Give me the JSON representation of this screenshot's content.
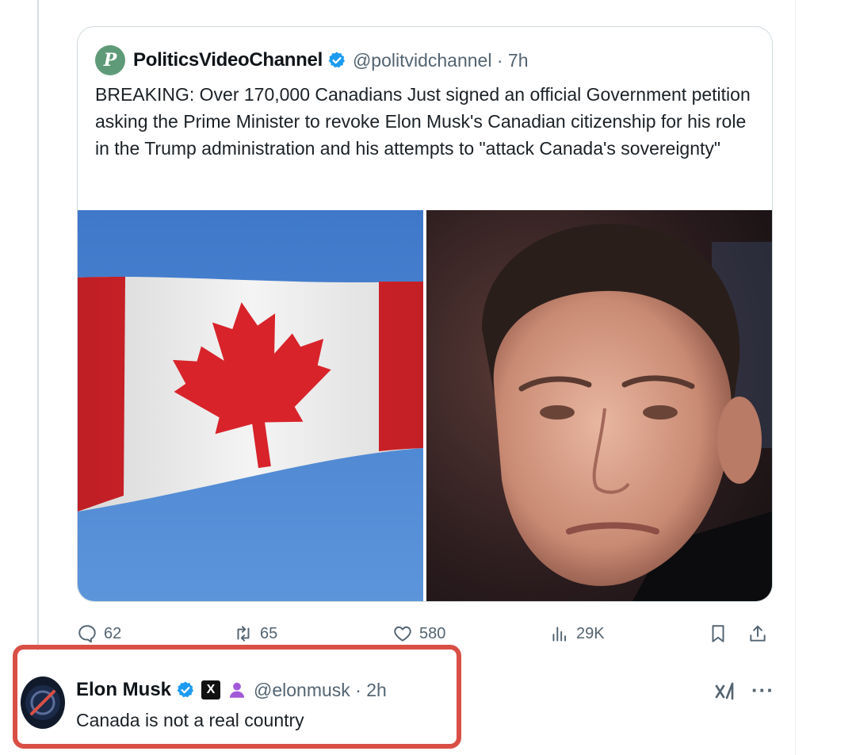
{
  "quoted_post": {
    "author_name": "PoliticsVideoChannel",
    "avatar_letter": "P",
    "handle_time": "@politvidchannel · 7h",
    "text": "BREAKING: Over 170,000 Canadians Just signed an official Government petition asking the Prime Minister to revoke Elon Musk's Canadian citizenship for his role in the Trump administration and his attempts to \"attack Canada's sovereignty\""
  },
  "actions": {
    "replies": "62",
    "reposts": "65",
    "likes": "580",
    "views": "29K"
  },
  "reply": {
    "author_name": "Elon Musk",
    "x_badge": "X",
    "handle_time": "@elonmusk · 2h",
    "text": "Canada is not a real country",
    "more": "···"
  },
  "colors": {
    "verified_blue": "#1d9bf0",
    "highlight_red": "#d94f45",
    "muted_text": "#536471"
  },
  "icons": [
    "verified-badge-icon",
    "reply-icon",
    "repost-icon",
    "like-icon",
    "views-icon",
    "bookmark-icon",
    "share-icon",
    "grok-icon",
    "more-icon",
    "affiliate-person-icon"
  ]
}
